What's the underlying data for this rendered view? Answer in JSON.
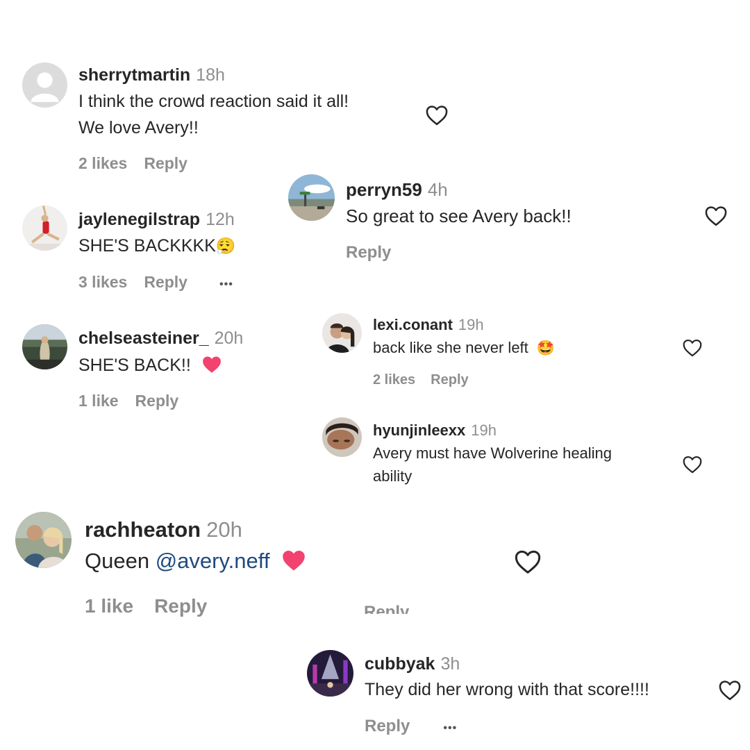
{
  "comments": [
    {
      "username": "sherrytmartin",
      "time": "18h",
      "text_line1": "I think the crowd reaction said it all!",
      "text_line2": "We love Avery!!",
      "likes": "2 likes",
      "reply": "Reply"
    },
    {
      "username": "jaylenegilstrap",
      "time": "12h",
      "text": "SHE'S BACKKKK",
      "emoji": "😮‍💨",
      "likes": "3 likes",
      "reply": "Reply",
      "more": "•••"
    },
    {
      "username": "chelseasteiner_",
      "time": "20h",
      "text": "SHE'S BACK!!",
      "emoji": "💗",
      "likes": "1 like",
      "reply": "Reply"
    },
    {
      "username": "rachheaton",
      "time": "20h",
      "text_prefix": "Queen",
      "mention": "@avery.neff",
      "emoji": "❤",
      "likes": "1 like",
      "reply": "Reply"
    }
  ],
  "replies": [
    {
      "username": "perryn59",
      "time": "4h",
      "text": "So great to see Avery back!!",
      "reply": "Reply"
    },
    {
      "username": "lexi.conant",
      "time": "19h",
      "text": "back like she never left",
      "emoji": "🤩",
      "likes": "2 likes",
      "reply": "Reply"
    },
    {
      "username": "hyunjinleexx",
      "time": "19h",
      "text_line1": "Avery must have Wolverine healing",
      "text_line2": "ability"
    },
    {
      "username": "cubbyak",
      "time": "3h",
      "text": "They did her wrong with that score!!!!",
      "reply": "Reply",
      "more": "•••"
    }
  ],
  "clipped_reply": "Reply",
  "colors": {
    "heart_pink": "#f2426f",
    "mention": "#1f4a7f",
    "muted": "#8e8e8e"
  }
}
